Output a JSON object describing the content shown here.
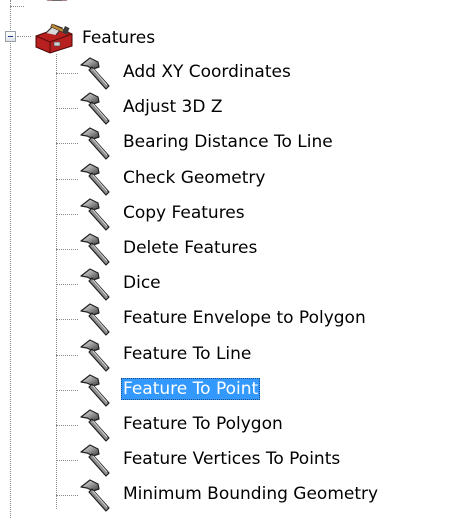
{
  "tree": {
    "node": {
      "label": "Features",
      "icon": "toolbox-icon",
      "expander": "collapse-minus"
    },
    "items": [
      {
        "label": "Add XY Coordinates",
        "icon": "hammer-icon",
        "selected": false
      },
      {
        "label": "Adjust 3D Z",
        "icon": "hammer-icon",
        "selected": false
      },
      {
        "label": "Bearing Distance To Line",
        "icon": "hammer-icon",
        "selected": false
      },
      {
        "label": "Check Geometry",
        "icon": "hammer-icon",
        "selected": false
      },
      {
        "label": "Copy Features",
        "icon": "hammer-icon",
        "selected": false
      },
      {
        "label": "Delete Features",
        "icon": "hammer-icon",
        "selected": false
      },
      {
        "label": "Dice",
        "icon": "hammer-icon",
        "selected": false
      },
      {
        "label": "Feature Envelope to Polygon",
        "icon": "hammer-icon",
        "selected": false
      },
      {
        "label": "Feature To Line",
        "icon": "hammer-icon",
        "selected": false
      },
      {
        "label": "Feature To Point",
        "icon": "hammer-icon",
        "selected": true
      },
      {
        "label": "Feature To Polygon",
        "icon": "hammer-icon",
        "selected": false
      },
      {
        "label": "Feature Vertices To Points",
        "icon": "hammer-icon",
        "selected": false
      },
      {
        "label": "Minimum Bounding Geometry",
        "icon": "hammer-icon",
        "selected": false
      }
    ],
    "colors": {
      "selection": "#3399ff",
      "connector": "#8a8a8a"
    }
  }
}
